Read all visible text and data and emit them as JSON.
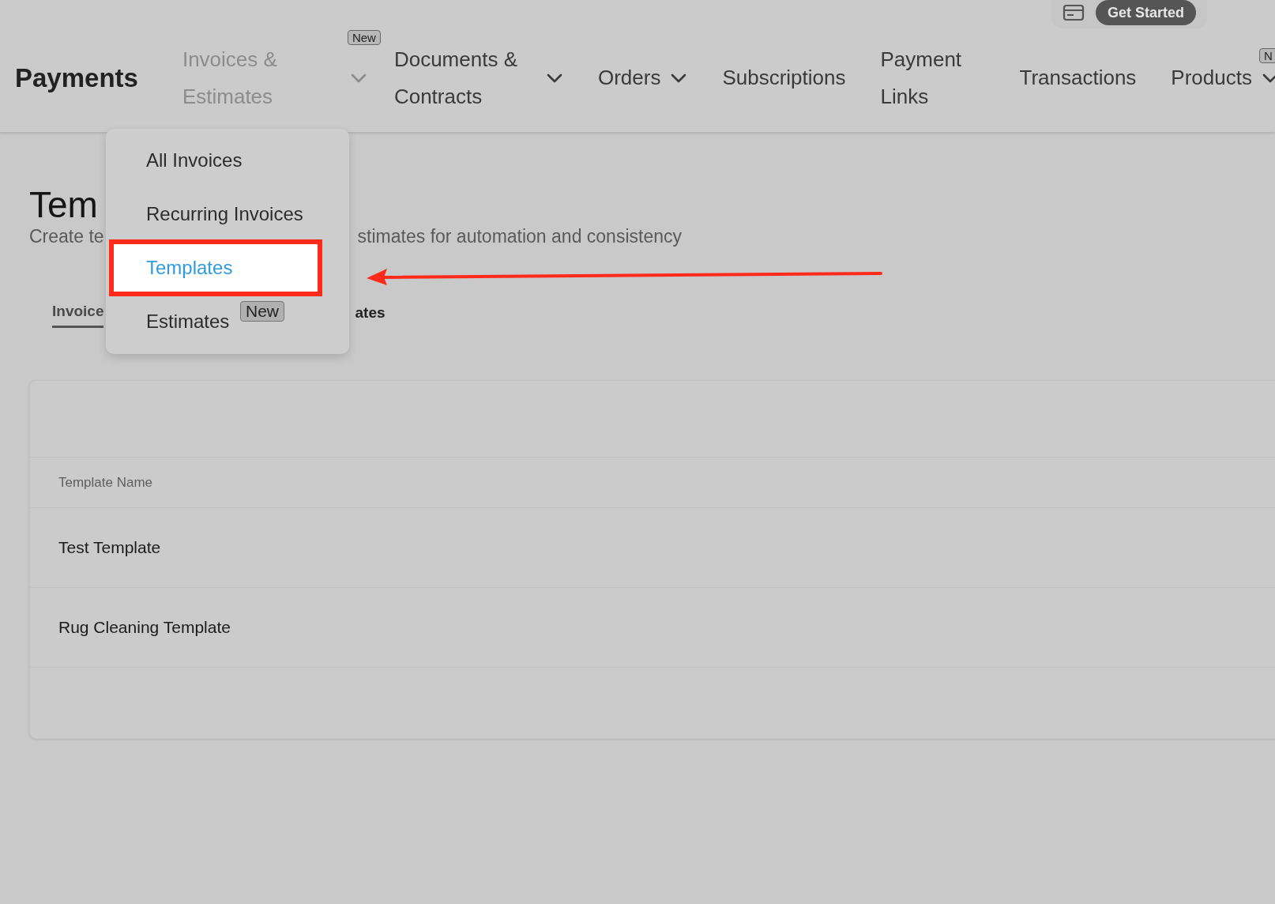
{
  "top_bar": {
    "button": "Get Started"
  },
  "header": {
    "title": "Payments"
  },
  "nav": [
    {
      "label": "Invoices & Estimates",
      "selected": true,
      "dropdown": true,
      "badge": "New"
    },
    {
      "label": "Documents & Contracts",
      "selected": false,
      "dropdown": true
    },
    {
      "label": "Orders",
      "selected": false,
      "dropdown": true
    },
    {
      "label": "Subscriptions",
      "selected": false,
      "dropdown": false
    },
    {
      "label": "Payment Links",
      "selected": false,
      "dropdown": false
    },
    {
      "label": "Transactions",
      "selected": false,
      "dropdown": false
    },
    {
      "label": "Products",
      "selected": false,
      "dropdown": true,
      "badge": "N"
    }
  ],
  "dropdown_menu": [
    {
      "label": "All Invoices",
      "selected": false
    },
    {
      "label": "Recurring Invoices",
      "selected": false
    },
    {
      "label": "Templates",
      "selected": true
    },
    {
      "label": "Estimates",
      "selected": false,
      "badge": "New"
    }
  ],
  "page": {
    "title": "Tem",
    "subtitle_start": "Create te",
    "subtitle_end": "stimates for automation and consistency"
  },
  "tabs": [
    {
      "label": "Invoice",
      "selected": true
    },
    {
      "label": "ates",
      "selected": false
    }
  ],
  "table": {
    "columns": [
      "Template Name"
    ],
    "rows": [
      [
        "Test Template"
      ],
      [
        "Rug Cleaning Template"
      ]
    ]
  }
}
